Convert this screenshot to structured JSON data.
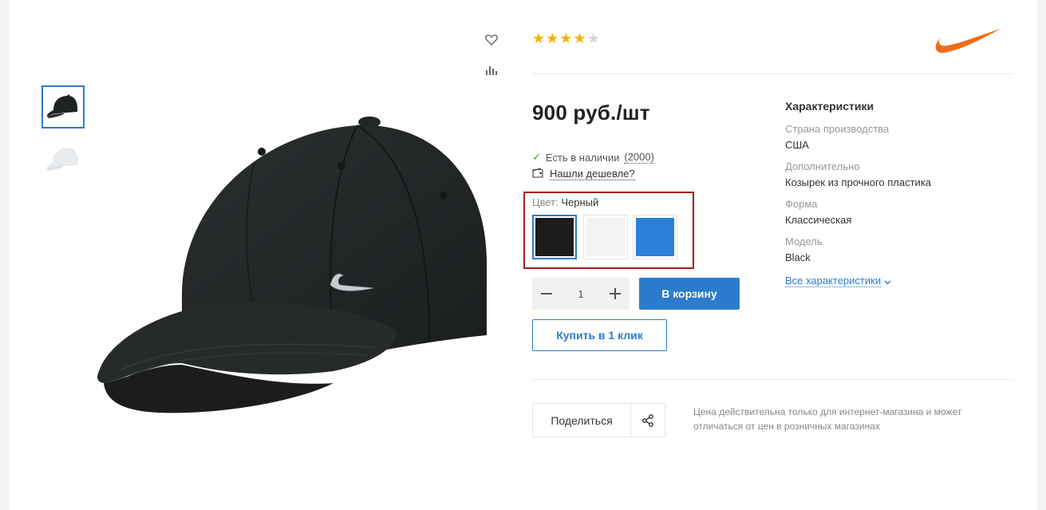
{
  "product": {
    "rating": 4,
    "rating_max": 5,
    "price": "900 руб./шт",
    "stock": {
      "text": "Есть в наличии",
      "count": "(2000)"
    },
    "cheaper_link": "Нашли дешевле?",
    "color": {
      "label": "Цвет:",
      "selected": "Черный",
      "options": [
        {
          "name": "black",
          "hex": "#1c1c1c"
        },
        {
          "name": "white",
          "hex": "#f2f2f2"
        },
        {
          "name": "blue",
          "hex": "#2b80d8"
        }
      ]
    },
    "quantity": "1",
    "add_to_cart": "В корзину",
    "one_click": "Купить в 1 клик"
  },
  "share": {
    "label": "Поделиться"
  },
  "note": "Цена действительна только для интернет-магазина и может отличаться от цен в розничных магазинах",
  "characteristics": {
    "title": "Характеристики",
    "items": [
      {
        "key": "Страна производства",
        "value": "США"
      },
      {
        "key": "Дополнительно",
        "value": "Козырек из прочного пластика"
      },
      {
        "key": "Форма",
        "value": "Классическая"
      },
      {
        "key": "Модель",
        "value": "Black"
      }
    ],
    "all_link": "Все характеристики"
  },
  "colors": {
    "accent": "#2b7ccc",
    "highlight_border": "#a61d1d",
    "star": "#f5b301",
    "star_empty": "#d6d6d6",
    "brand": "#f26a18"
  },
  "icons": [
    "heart-icon",
    "compare-icon",
    "check-icon",
    "wallet-icon",
    "minus-icon",
    "plus-icon",
    "share-icon",
    "chevron-down-icon",
    "nike-swoosh-logo"
  ]
}
